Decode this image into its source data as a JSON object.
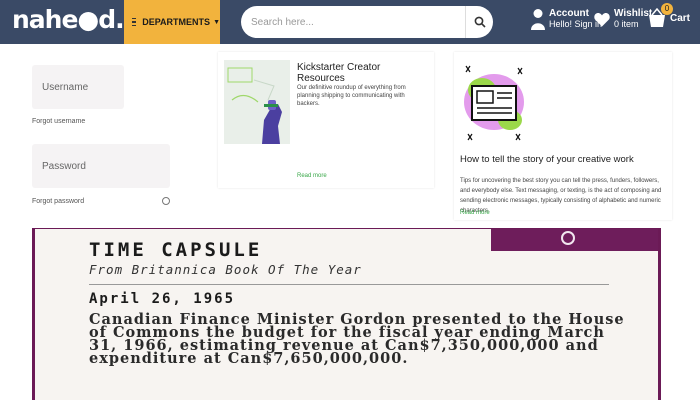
{
  "header": {
    "logo": "nahe●d.pk",
    "departments_label": "DEPARTMENTS",
    "search_placeholder": "Search here...",
    "account": {
      "title": "Account",
      "sub": "Hello! Sign in"
    },
    "wishlist": {
      "title": "Wishlist",
      "sub": "0 item"
    },
    "cart": {
      "title": "Cart",
      "count": "0"
    }
  },
  "login": {
    "username_placeholder": "Username",
    "forgot_username": "Forgot username",
    "password_placeholder": "Password",
    "forgot_password": "Forgot password"
  },
  "cards": [
    {
      "title": "Kickstarter Creator Resources",
      "desc": "Our definitive roundup of everything from planning shipping to communicating with backers.",
      "read_more": "Read more"
    },
    {
      "title": "How to tell the story of your creative work",
      "desc": "Tips for uncovering the best story you can tell the press, funders, followers, and everybody else. Text messaging, or texting, is the act of composing and sending electronic messages, typically consisting of alphabetic and numeric characters.",
      "read_more": "Read more"
    }
  ],
  "time_capsule": {
    "title": "TIME CAPSULE",
    "subtitle": "From Britannica Book Of The Year",
    "date": "April 26, 1965",
    "body": "Canadian Finance Minister Gordon presented to the House of Commons the budget for the fiscal year ending March 31, 1966, estimating revenue at Can$7,350,000,000 and expenditure at Can$7,650,000,000."
  },
  "colors": {
    "header_bg": "#3a4a66",
    "departments_bg": "#f2b33d",
    "accent_purple": "#6e1d5b",
    "read_more": "#3aa84a"
  }
}
